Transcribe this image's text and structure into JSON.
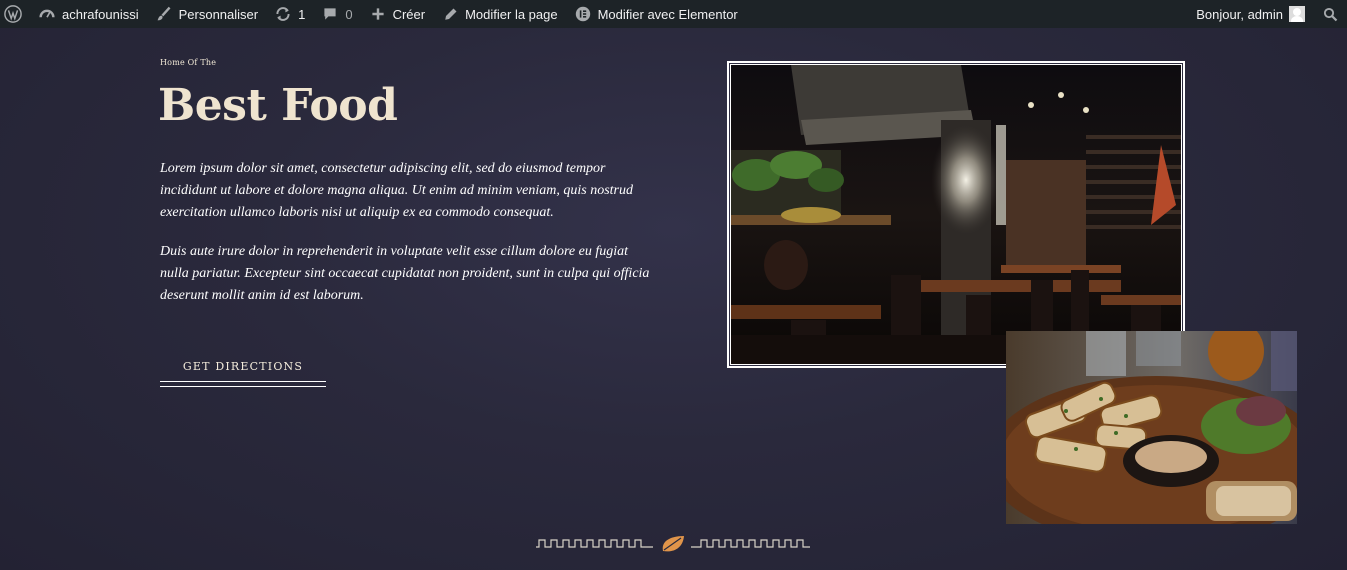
{
  "adminbar": {
    "site_name": "achrafounissi",
    "customize": "Personnaliser",
    "updates_count": "1",
    "comments_count": "0",
    "create": "Créer",
    "edit_page": "Modifier la page",
    "edit_elementor": "Modifier avec Elementor",
    "greeting": "Bonjour, admin"
  },
  "hero": {
    "kicker": "Home Of The",
    "headline": "Best Food",
    "paragraph_1": "Lorem ipsum dolor sit amet, consectetur adipiscing elit, sed do eiusmod tempor incididunt ut labore et dolore magna aliqua. Ut enim ad minim veniam, quis nostrud exercitation ullamco laboris nisi ut aliquip ex ea commodo consequat.",
    "paragraph_2": "Duis aute irure dolor in reprehenderit in voluptate velit esse cillum dolore eu fugiat nulla pariatur. Excepteur sint occaecat cupidatat non proident, sunt in culpa qui officia deserunt mollit anim id est laborum.",
    "cta_label": "GET DIRECTIONS"
  },
  "colors": {
    "background": "#2a293c",
    "adminbar": "#1d2327",
    "headline": "#efe4cf",
    "leaf_accent": "#e0944a"
  },
  "icons": {
    "wp": "wordpress-logo-icon",
    "dashboard": "dashboard-icon",
    "brush": "brush-icon",
    "updates": "updates-icon",
    "comments": "comment-icon",
    "plus": "plus-icon",
    "pencil": "pencil-icon",
    "elementor": "elementor-icon",
    "search": "search-icon",
    "leaf": "leaf-icon"
  }
}
